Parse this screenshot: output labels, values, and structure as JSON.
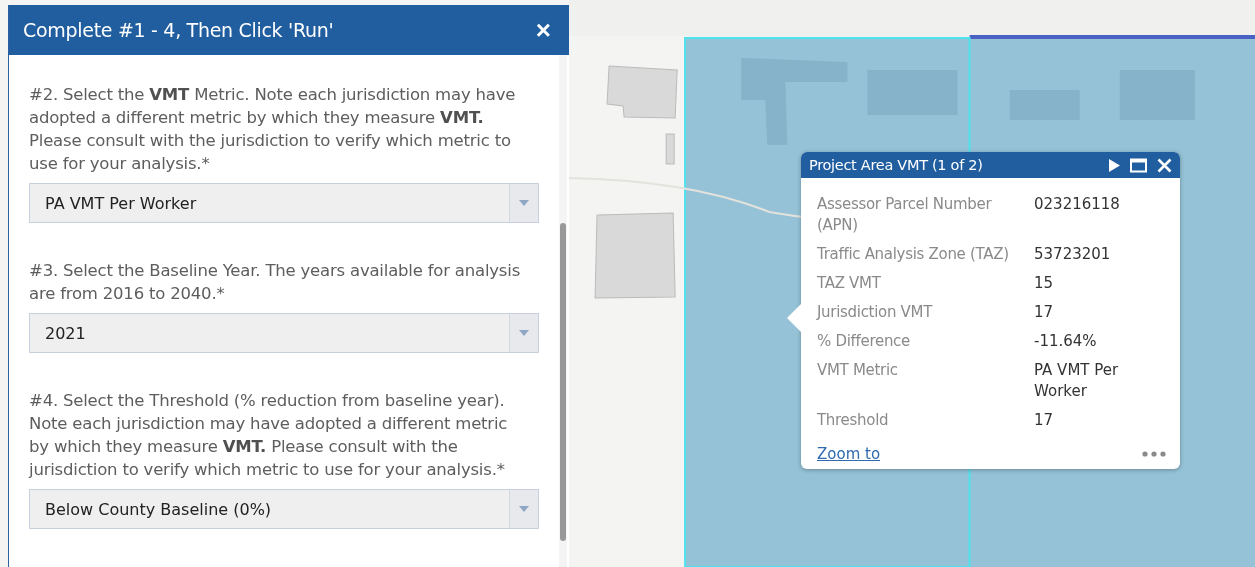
{
  "panel": {
    "title": "Complete #1 - 4, Then Click 'Run'",
    "close_icon": "×",
    "steps": [
      {
        "instruction": "#2. Select the **VMT** Metric. Note each jurisdiction may have adopted a different metric by which they measure **VMT.** Please consult with the jurisdiction to verify which metric to use for your analysis.*",
        "value": "PA VMT Per Worker"
      },
      {
        "instruction": "#3. Select the Baseline Year. The years available for analysis are from 2016 to 2040.*",
        "value": "2021"
      },
      {
        "instruction": "#4. Select the Threshold (% reduction from baseline year). Note each jurisdiction may have adopted a different metric by which they measure **VMT.** Please consult with the jurisdiction to verify which metric to use for your analysis.*",
        "value": "Below County Baseline (0%)"
      }
    ]
  },
  "popup": {
    "title": "Project Area VMT (1 of 2)",
    "fields": [
      {
        "label": "Assessor Parcel Number (APN)",
        "value": "023216118"
      },
      {
        "label": "Traffic Analysis Zone (TAZ)",
        "value": "53723201"
      },
      {
        "label": "TAZ VMT",
        "value": "15"
      },
      {
        "label": "Jurisdiction VMT",
        "value": "17"
      },
      {
        "label": "% Difference",
        "value": "-11.64%"
      },
      {
        "label": "VMT Metric",
        "value": "PA VMT Per Worker"
      },
      {
        "label": "Threshold",
        "value": "17"
      }
    ],
    "link": "Zoom to"
  }
}
